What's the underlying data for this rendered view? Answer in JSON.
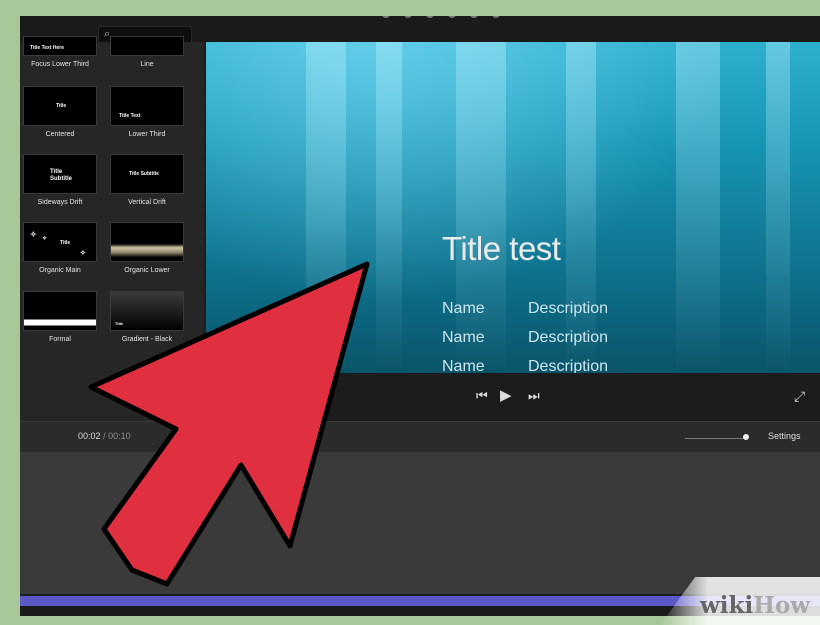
{
  "titles_browser": {
    "search_icon": "magnifier-icon",
    "items": [
      {
        "label": "Focus Lower Third",
        "preview": "Title Text Here"
      },
      {
        "label": "Line",
        "preview": ""
      },
      {
        "label": "Centered",
        "preview": "Title"
      },
      {
        "label": "Lower Third",
        "preview": "Title Text"
      },
      {
        "label": "Sideways Drift",
        "preview": "Title Subtitle"
      },
      {
        "label": "Vertical Drift",
        "preview": "Title Subtitle"
      },
      {
        "label": "Organic Main",
        "preview": "Title"
      },
      {
        "label": "Organic Lower",
        "preview": ""
      },
      {
        "label": "Formal",
        "preview": ""
      },
      {
        "label": "Gradient - Black",
        "preview": "Title"
      }
    ]
  },
  "viewer": {
    "title": "Title test",
    "rows": [
      {
        "name": "Name",
        "description": "Description"
      },
      {
        "name": "Name",
        "description": "Description"
      },
      {
        "name": "Name",
        "description": "Description"
      }
    ]
  },
  "transport": {
    "prev_icon": "skip-back-icon",
    "play_icon": "play-icon",
    "next_icon": "skip-forward-icon",
    "fullscreen_icon": "fullscreen-icon"
  },
  "timeline": {
    "current_time": "00:02",
    "separator": "/",
    "total_time": "00:10",
    "settings_label": "Settings"
  },
  "watermark": {
    "text_a": "wiki",
    "text_b": "How"
  },
  "colors": {
    "arrow": "#e03040",
    "timeline_accent": "#5b58c7",
    "frame": "#a8c89a"
  }
}
